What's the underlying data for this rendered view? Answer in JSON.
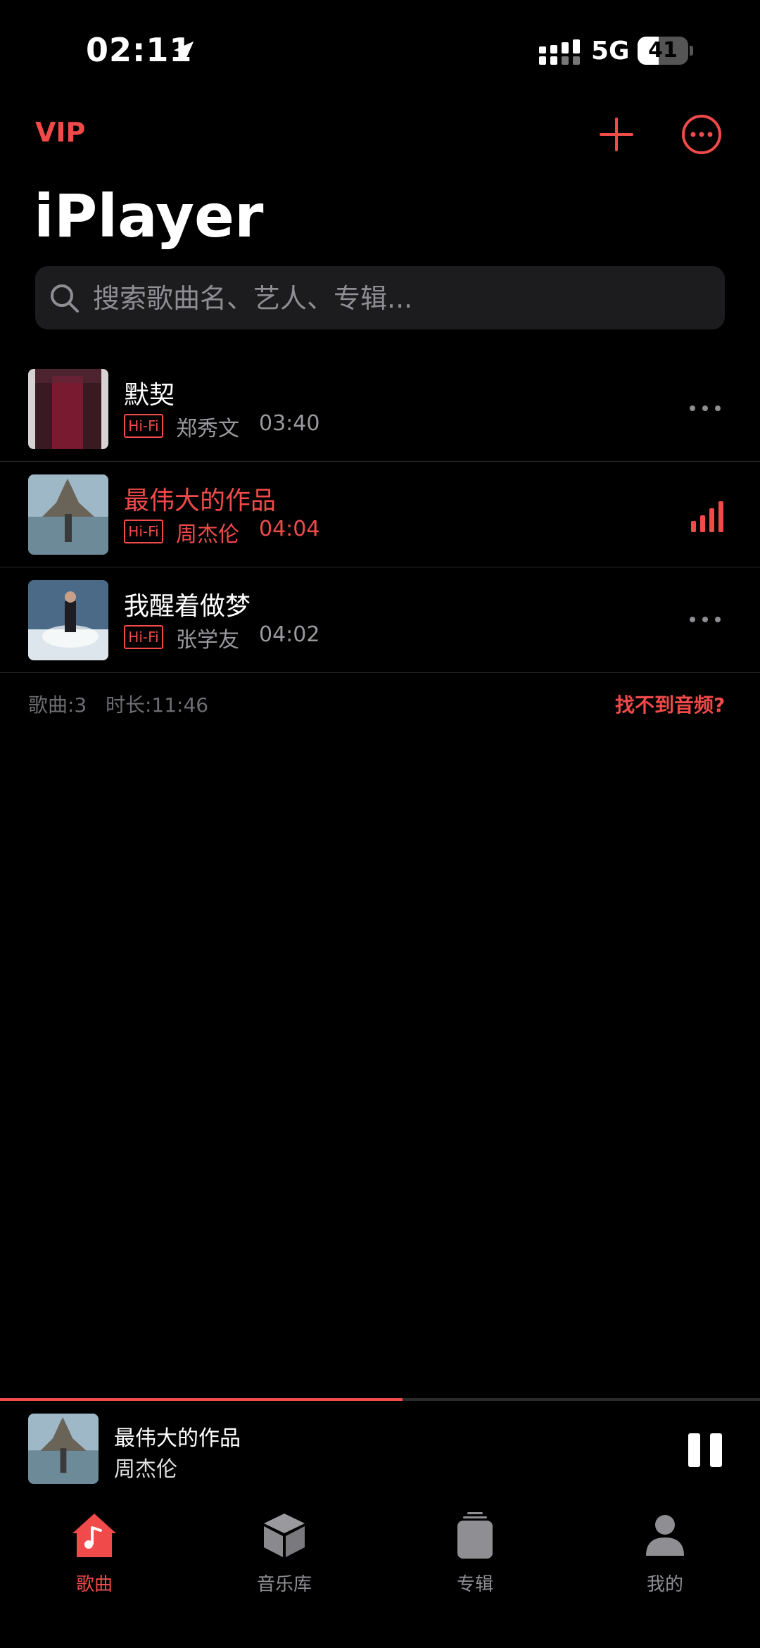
{
  "status_bar": {
    "time": "02:11",
    "network": "5G",
    "battery_level": 41,
    "battery_text": "41"
  },
  "header": {
    "vip_label": "VIP",
    "title": "iPlayer"
  },
  "search": {
    "placeholder": "搜索歌曲名、艺人、专辑..."
  },
  "songs": [
    {
      "title": "默契",
      "badge": "Hi-Fi",
      "artist": "郑秀文",
      "duration": "03:40",
      "playing": false
    },
    {
      "title": "最伟大的作品",
      "badge": "Hi-Fi",
      "artist": "周杰伦",
      "duration": "04:04",
      "playing": true
    },
    {
      "title": "我醒着做梦",
      "badge": "Hi-Fi",
      "artist": "张学友",
      "duration": "04:02",
      "playing": false
    }
  ],
  "summary": {
    "count": "歌曲:3",
    "duration": "时长:11:46",
    "help_link": "找不到音频?"
  },
  "now_playing": {
    "title": "最伟大的作品",
    "artist": "周杰伦",
    "progress": 0.53
  },
  "tabs": [
    {
      "label": "歌曲",
      "icon": "home-music-icon",
      "active": true
    },
    {
      "label": "音乐库",
      "icon": "box-icon",
      "active": false
    },
    {
      "label": "专辑",
      "icon": "album-stack-icon",
      "active": false
    },
    {
      "label": "我的",
      "icon": "person-icon",
      "active": false
    }
  ],
  "colors": {
    "accent": "#f04a4a",
    "background": "#000000",
    "secondary_text": "#9a9a9e"
  }
}
